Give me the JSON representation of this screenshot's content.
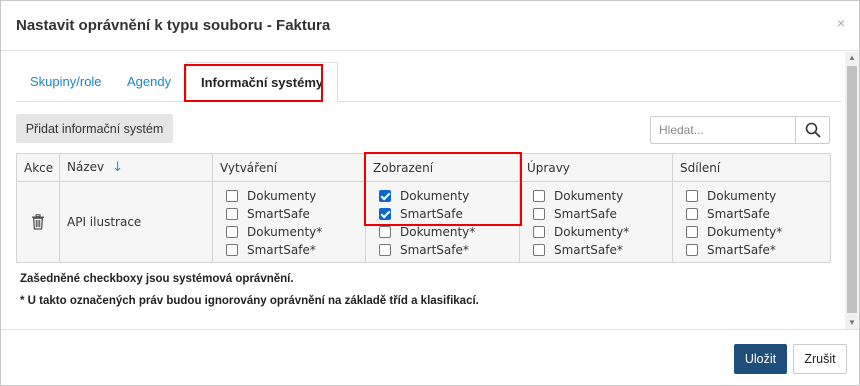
{
  "dialog": {
    "title": "Nastavit oprávnění k typu souboru - Faktura",
    "close_label": "×"
  },
  "tabs": [
    {
      "label": "Skupiny/role",
      "active": false
    },
    {
      "label": "Agendy",
      "active": false
    },
    {
      "label": "Informační systémy",
      "active": true
    }
  ],
  "toolbar": {
    "add_label": "Přidat informační systém",
    "search_placeholder": "Hledat..."
  },
  "table": {
    "headers": {
      "actions": "Akce",
      "name": "Název",
      "name_sort": "↓",
      "create": "Vytváření",
      "view": "Zobrazení",
      "edit": "Úpravy",
      "share": "Sdílení"
    },
    "rows": [
      {
        "name": "API ilustrace",
        "create": [
          {
            "label": "Dokumenty",
            "checked": false
          },
          {
            "label": "SmartSafe",
            "checked": false
          },
          {
            "label": "Dokumenty*",
            "checked": false
          },
          {
            "label": "SmartSafe*",
            "checked": false
          }
        ],
        "view": [
          {
            "label": "Dokumenty",
            "checked": true
          },
          {
            "label": "SmartSafe",
            "checked": true
          },
          {
            "label": "Dokumenty*",
            "checked": false
          },
          {
            "label": "SmartSafe*",
            "checked": false
          }
        ],
        "edit": [
          {
            "label": "Dokumenty",
            "checked": false
          },
          {
            "label": "SmartSafe",
            "checked": false
          },
          {
            "label": "Dokumenty*",
            "checked": false
          },
          {
            "label": "SmartSafe*",
            "checked": false
          }
        ],
        "share": [
          {
            "label": "Dokumenty",
            "checked": false
          },
          {
            "label": "SmartSafe",
            "checked": false
          },
          {
            "label": "Dokumenty*",
            "checked": false
          },
          {
            "label": "SmartSafe*",
            "checked": false
          }
        ]
      }
    ]
  },
  "notes": {
    "system_note": "Zašedněné checkboxy jsou systémová oprávnění.",
    "ignored_note": "* U takto označených práv budou ignorovány oprávnění na základě tříd a klasifikací."
  },
  "footer": {
    "save_label": "Uložit",
    "cancel_label": "Zrušit"
  },
  "colors": {
    "accent": "#1f4e7a",
    "link": "#1c86c8",
    "checkbox": "#0a66d1",
    "highlight": "#e00000"
  },
  "icons": {
    "close": "close-icon",
    "search": "search-icon",
    "delete": "trash-icon",
    "sort": "arrow-down-icon"
  }
}
